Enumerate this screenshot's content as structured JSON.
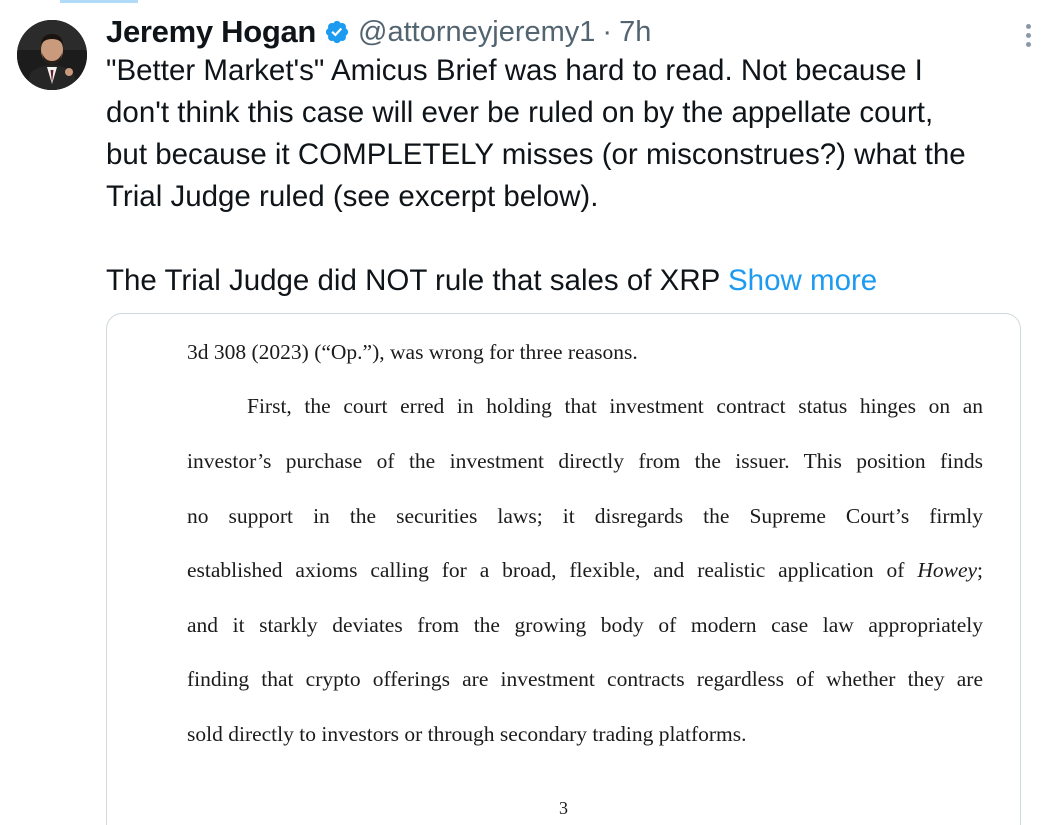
{
  "author": {
    "display_name": "Jeremy Hogan",
    "handle": "@attorneyjeremy1",
    "separator": "·",
    "time": "7h",
    "verified_icon": "verified-badge-icon",
    "verified_color": "#1d9bf0"
  },
  "tweet": {
    "paragraph_1": "\"Better Market's\" Amicus Brief was hard to read. Not because I\ndon't think this case will ever be ruled on by the appellate court,\nbut because it COMPLETELY misses (or misconstrues?) what the\nTrial Judge ruled (see excerpt below).",
    "paragraph_2": "The Trial Judge did NOT rule that sales of XRP",
    "show_more": "Show more"
  },
  "document": {
    "lines": [
      "3d 308 (2023) (“Op.”), was wrong for three reasons.",
      "First, the court erred in holding that investment contract status hinges on an",
      "investor’s purchase of the investment directly from the issuer.   This position finds",
      "no support in the securities laws; it disregards the Supreme Court’s firmly",
      "established axioms calling for a broad, flexible, and realistic application of",
      "Howey",
      ";",
      "and it starkly deviates from the growing body of modern case law appropriately",
      "finding that crypto offerings are investment contracts regardless of whether they are",
      "sold directly to investors or through secondary trading platforms."
    ],
    "page_number": "3"
  },
  "colors": {
    "text": "#0f1419",
    "secondary": "#536471",
    "link": "#1d9bf0",
    "border": "#cfd9de"
  }
}
